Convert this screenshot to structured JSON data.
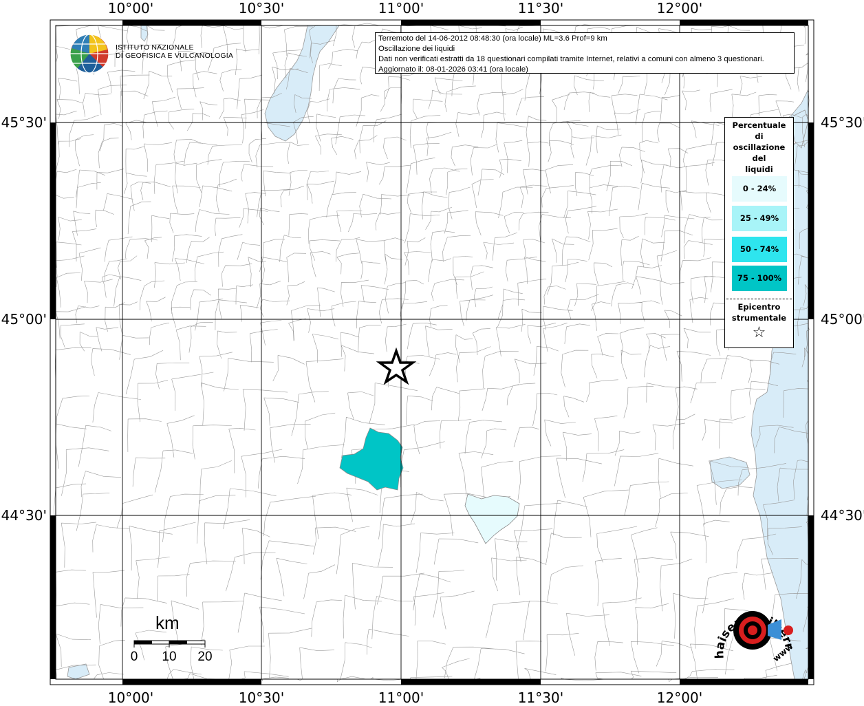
{
  "map": {
    "lon_ticks": [
      "10°00'",
      "10°30'",
      "11°00'",
      "11°30'",
      "12°00'"
    ],
    "lat_ticks": [
      "45°30'",
      "45°00'",
      "44°30'"
    ]
  },
  "info": {
    "line1": "Terremoto del 14-06-2012 08:48:30 (ora locale) ML=3.6 Prof=9 km",
    "line2": "Oscillazione dei liquidi",
    "line3": "Dati non verificati estratti da 18 questionari compilati tramite Internet, relativi a comuni con almeno 3 questionari.",
    "line4": "Aggiornato il: 08-01-2026 03:41 (ora locale)"
  },
  "logo": {
    "line1": "ISTITUTO NAZIONALE",
    "line2": "DI GEOFISICA E VULCANOLOGIA"
  },
  "legend": {
    "title": [
      "Percentuale",
      "di",
      "oscillazione",
      "del",
      "liquidi"
    ],
    "items": [
      {
        "label": "0 - 24%",
        "color": "#e6fbfd"
      },
      {
        "label": "25 - 49%",
        "color": "#a8f4f8"
      },
      {
        "label": "50 - 74%",
        "color": "#2ee5ee"
      },
      {
        "label": "75 - 100%",
        "color": "#00c5c6"
      }
    ],
    "epicentro": [
      "Epicentro",
      "strumentale"
    ],
    "star_symbol": "☆"
  },
  "scale": {
    "unit": "km",
    "labels": [
      "0",
      "10",
      "20"
    ]
  },
  "watermark": {
    "text": "haisentitoilterremoto.it",
    "www": "www"
  },
  "colors": {
    "water": "#d8ecf8",
    "border": "#9a9a9a",
    "highlight_75_100": "#00c5c6",
    "highlight_0_24": "#e6fbfd"
  },
  "epicenter": {
    "lon": "10°58'",
    "lat": "44°53'"
  }
}
